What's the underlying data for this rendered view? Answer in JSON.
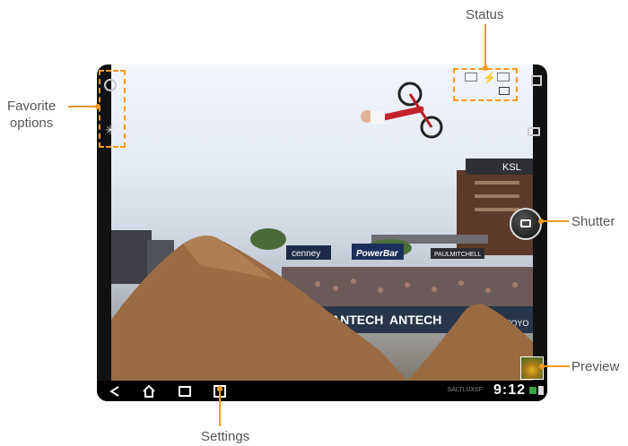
{
  "labels": {
    "status": "Status",
    "favorite_line1": "Favorite",
    "favorite_line2": "options",
    "shutter": "Shutter",
    "preview": "Preview",
    "settings": "Settings"
  },
  "system_bar": {
    "time": "9:12",
    "carrier": "SALTLUXSF"
  },
  "scene_signs": [
    "cenney",
    "PowerBar",
    "PAULMITCHELL",
    "KSL",
    "ANTECH",
    "ANTECH",
    "TOYO"
  ],
  "colors": {
    "accent": "#f39a1e",
    "label_text": "#555555",
    "system_bar_bg": "#000000",
    "tablet_bezel": "#111111"
  }
}
